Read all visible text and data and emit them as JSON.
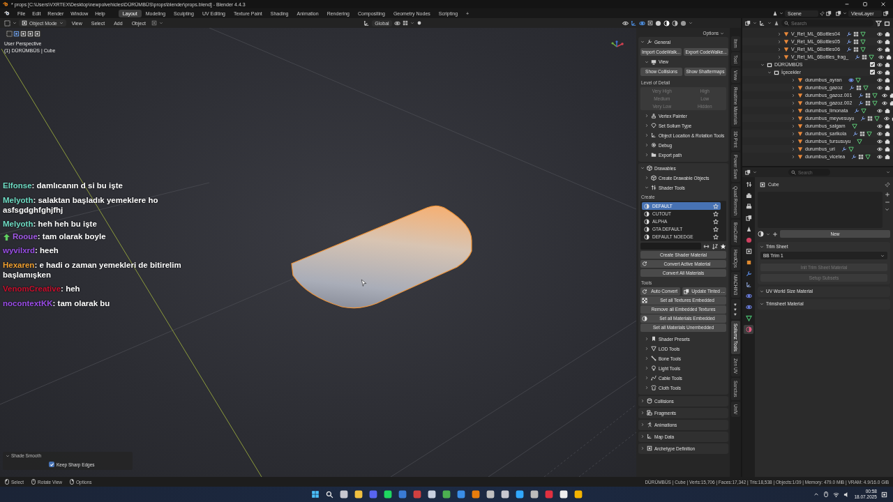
{
  "window": {
    "title": "* props [C:\\Users\\VXRTEX\\Desktop\\newpolvehicles\\DÜRÜMBÜS\\props\\blender\\props.blend] - Blender 4.4.3"
  },
  "menu": [
    "File",
    "Edit",
    "Render",
    "Window",
    "Help"
  ],
  "workspaces": [
    {
      "label": "Layout",
      "selected": true
    },
    {
      "label": "Modeling",
      "selected": false
    },
    {
      "label": "Sculpting",
      "selected": false
    },
    {
      "label": "UV Editing",
      "selected": false
    },
    {
      "label": "Texture Paint",
      "selected": false
    },
    {
      "label": "Shading",
      "selected": false
    },
    {
      "label": "Animation",
      "selected": false
    },
    {
      "label": "Rendering",
      "selected": false
    },
    {
      "label": "Compositing",
      "selected": false
    },
    {
      "label": "Geometry Nodes",
      "selected": false
    },
    {
      "label": "Scripting",
      "selected": false
    }
  ],
  "add_workspace": "+",
  "scene": "Scene",
  "view_layer": "ViewLayer",
  "viewport_header": {
    "mode": "Object Mode",
    "menus": [
      "View",
      "Select",
      "Add",
      "Object"
    ],
    "orientation": "Global"
  },
  "viewport": {
    "view_name": "User Perspective",
    "object_info": "(1) DÜRÜMBÜS | Cube"
  },
  "chat": [
    {
      "user": "Elfonse",
      "color": "#6fdcc4",
      "badge": false,
      "message": ": damlıcanın d si bu işte"
    },
    {
      "user": "Melyoth",
      "color": "#6fdcc4",
      "badge": false,
      "message": ": salaktan başladık yemeklere ho asfsgdghfghjfhj"
    },
    {
      "user": "Melyoth",
      "color": "#6fdcc4",
      "badge": false,
      "message": ": heh heh bu işte"
    },
    {
      "user": "Rooue",
      "color": "#a35ae8",
      "badge": true,
      "message": ": tam olarak boyle"
    },
    {
      "user": "wyvilxrd",
      "color": "#9a4fe6",
      "badge": false,
      "message": ": heeh"
    },
    {
      "user": "Hexaren",
      "color": "#f0a030",
      "badge": false,
      "message": ": e hadi o zaman yemekleri de bitirelim başlamışken"
    },
    {
      "user": "VenomCreative",
      "color": "#c8102e",
      "badge": false,
      "message": ": heh"
    },
    {
      "user": "nocontextKK",
      "color": "#9b4de8",
      "badge": false,
      "message": ": tam olarak bu"
    }
  ],
  "operator_panel": {
    "title": "Shade Smooth",
    "expanded": true,
    "options": [
      {
        "label": "Keep Sharp Edges",
        "checked": true
      }
    ]
  },
  "n_panel": {
    "options": "Options",
    "panels": [
      {
        "kind": "panel",
        "title": "General",
        "expanded": true,
        "children": [
          {
            "kind": "buttons",
            "buttons": [
              {
                "label": "Import CodeWalk...",
                "disabled": false
              },
              {
                "label": "Export CodeWalke...",
                "disabled": false
              }
            ]
          },
          {
            "kind": "panel",
            "title": "View",
            "expanded": true,
            "children": [
              {
                "kind": "buttons",
                "buttons": [
                  {
                    "label": "Show Collisions",
                    "disabled": false
                  },
                  {
                    "label": "Show Shattermaps",
                    "disabled": false
                  }
                ]
              }
            ]
          },
          {
            "kind": "label",
            "text": "Level of Detail"
          },
          {
            "kind": "grid",
            "buttons": [
              {
                "label": "Very High",
                "disabled": true
              },
              {
                "label": "High",
                "disabled": true
              },
              {
                "label": "Medium",
                "disabled": true
              },
              {
                "label": "Low",
                "disabled": true
              },
              {
                "label": "Very Low",
                "disabled": true
              },
              {
                "label": "Hidden",
                "disabled": true
              }
            ]
          },
          {
            "kind": "panel",
            "title": "Vertex Painter",
            "expanded": false
          },
          {
            "kind": "panel",
            "title": "Set Sollum Type",
            "expanded": false
          },
          {
            "kind": "panel",
            "title": "Object Location & Rotation Tools",
            "expanded": false
          },
          {
            "kind": "panel",
            "title": "Debug",
            "expanded": false
          },
          {
            "kind": "panel",
            "title": "Export path",
            "expanded": false
          }
        ]
      },
      {
        "kind": "panel",
        "title": "Drawables",
        "expanded": true,
        "children": [
          {
            "kind": "panel",
            "title": "Create Drawable Objects",
            "expanded": false
          },
          {
            "kind": "panel",
            "title": "Shader Tools",
            "expanded": true,
            "children": [
              {
                "kind": "label",
                "text": "Create"
              },
              {
                "kind": "list",
                "items": [
                  {
                    "label": "DEFAULT",
                    "selected": true
                  },
                  {
                    "label": "CUTOUT",
                    "selected": false
                  },
                  {
                    "label": "ALPHA",
                    "selected": false
                  },
                  {
                    "label": "GTA DEFAULT",
                    "selected": false
                  },
                  {
                    "label": "DEFAULT NOEDGE",
                    "selected": false
                  }
                ]
              },
              {
                "kind": "buttons",
                "buttons": [
                  {
                    "label": "Create Shader Material",
                    "disabled": false
                  }
                ]
              },
              {
                "kind": "buttons",
                "buttons": [
                  {
                    "label": "Convert Active Material",
                    "disabled": false
                  }
                ]
              },
              {
                "kind": "buttons",
                "buttons": [
                  {
                    "label": "Convert All Materials",
                    "disabled": false
                  }
                ]
              },
              {
                "kind": "label",
                "text": "Tools"
              },
              {
                "kind": "buttons",
                "buttons": [
                  {
                    "label": "Auto Convert",
                    "disabled": false
                  },
                  {
                    "label": "Update Tinted ...",
                    "disabled": false
                  }
                ]
              },
              {
                "kind": "buttons",
                "buttons": [
                  {
                    "label": "Set all Textures Embedded",
                    "disabled": false
                  }
                ]
              },
              {
                "kind": "buttons",
                "buttons": [
                  {
                    "label": "Remove all Embedded Textures",
                    "disabled": false
                  }
                ]
              },
              {
                "kind": "buttons",
                "buttons": [
                  {
                    "label": "Set all Materials Embedded",
                    "disabled": false
                  }
                ]
              },
              {
                "kind": "buttons",
                "buttons": [
                  {
                    "label": "Set all Materials Unembedded",
                    "disabled": false
                  }
                ]
              }
            ]
          },
          {
            "kind": "panel",
            "title": "Shader Presets",
            "expanded": false
          },
          {
            "kind": "panel",
            "title": "LOD Tools",
            "expanded": false
          },
          {
            "kind": "panel",
            "title": "Bone Tools",
            "expanded": false
          },
          {
            "kind": "panel",
            "title": "Light Tools",
            "expanded": false
          },
          {
            "kind": "panel",
            "title": "Cable Tools",
            "expanded": false
          },
          {
            "kind": "panel",
            "title": "Cloth Tools",
            "expanded": false
          }
        ]
      },
      {
        "kind": "panel",
        "title": "Collisions",
        "expanded": false
      },
      {
        "kind": "panel",
        "title": "Fragments",
        "expanded": false
      },
      {
        "kind": "panel",
        "title": "Animations",
        "expanded": false
      },
      {
        "kind": "panel",
        "title": "Map Data",
        "expanded": false
      },
      {
        "kind": "panel",
        "title": "Archetype Definition",
        "expanded": false
      }
    ]
  },
  "side_tabs": [
    {
      "label": "Item",
      "selected": false
    },
    {
      "label": "Tool",
      "selected": false
    },
    {
      "label": "View",
      "selected": false
    },
    {
      "label": "Realtime Materials",
      "selected": false
    },
    {
      "label": "3D Print",
      "selected": false
    },
    {
      "label": "Power Save",
      "selected": false
    },
    {
      "label": "Quad Remesh",
      "selected": false
    },
    {
      "label": "BoxCutter",
      "selected": false
    },
    {
      "label": "HardOps",
      "selected": false
    },
    {
      "label": "MACHIN3",
      "selected": false
    },
    {
      "label": "♥♥♥",
      "selected": false
    },
    {
      "label": "Sollumz Tools",
      "selected": true
    },
    {
      "label": "Zen UV",
      "selected": false
    },
    {
      "label": "Sanctus",
      "selected": false
    },
    {
      "label": "UnIV",
      "selected": false
    }
  ],
  "outliner": {
    "search": {
      "placeholder": "Search"
    },
    "items": [
      {
        "name": "V_Ret_ML_6Bottles04",
        "kind": "object"
      },
      {
        "name": "V_Ret_ML_6Bottles05",
        "kind": "object"
      },
      {
        "name": "V_Ret_ML_6Bottles06",
        "kind": "object"
      },
      {
        "name": "V_Ret_ML_6Bottles_frag_",
        "kind": "object"
      },
      {
        "name": "DÜRÜMBÜS",
        "kind": "collection",
        "checked": true,
        "expanded": true,
        "children": [
          {
            "name": "İçecekler",
            "kind": "collection",
            "checked": true,
            "expanded": true,
            "children": [
              {
                "name": "durumbus_ayran",
                "kind": "object"
              },
              {
                "name": "durumbus_gazoz",
                "kind": "object"
              },
              {
                "name": "durumbus_gazoz.001",
                "kind": "object"
              },
              {
                "name": "durumbus_gazoz.002",
                "kind": "object"
              },
              {
                "name": "durumbus_limonata",
                "kind": "object"
              },
              {
                "name": "durumbus_meyvesuyu",
                "kind": "object"
              },
              {
                "name": "durumbus_salgam",
                "kind": "object"
              },
              {
                "name": "durumbus_sarikola",
                "kind": "object"
              },
              {
                "name": "durumbus_tursusuyu",
                "kind": "object"
              },
              {
                "name": "durumbus_uri",
                "kind": "object"
              },
              {
                "name": "durumbus_vicetea",
                "kind": "object"
              }
            ]
          }
        ]
      }
    ]
  },
  "properties": {
    "search": {
      "placeholder": "Search"
    },
    "tabs": [
      {
        "selected": false
      },
      {
        "selected": false
      },
      {
        "selected": false
      },
      {
        "selected": false
      },
      {
        "selected": false
      },
      {
        "selected": false
      },
      {
        "selected": false
      },
      {
        "selected": false
      },
      {
        "selected": false
      },
      {
        "selected": false
      },
      {
        "selected": false
      },
      {
        "selected": false
      },
      {
        "selected": false
      },
      {
        "selected": true
      }
    ],
    "object": "Cube",
    "new_button": "New",
    "panels": [
      {
        "title": "Trim Sheet",
        "expanded": true,
        "dropdown": "BB Trim 1",
        "buttons": [
          {
            "label": "Init Trim Sheet Material",
            "disabled": true
          },
          {
            "label": "Setup Subsets",
            "disabled": true
          }
        ]
      },
      {
        "title": "UV World Size Material",
        "expanded": true
      },
      {
        "title": "Trimsheet Material",
        "expanded": true
      }
    ]
  },
  "status_bar": {
    "hints": [
      "Select",
      "Rotate View",
      "Options"
    ],
    "stats": "DÜRÜMBÜS | Cube | Verts:15,706 | Faces:17,342 | Tris:18,538 | Objects:1/39 | Memory: 479.0 MiB | VRAM: 4.9/16.0 GiB"
  },
  "taskbar": {
    "time": "00:58",
    "date": "18.07.2025"
  }
}
